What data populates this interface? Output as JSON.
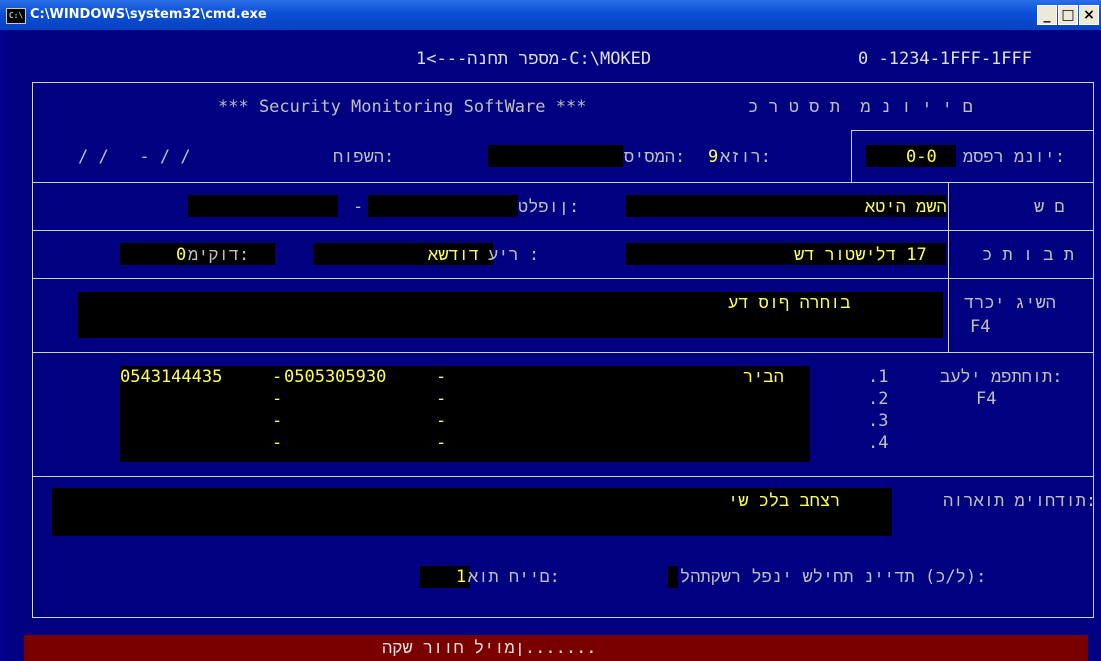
{
  "window": {
    "title": "C:\\WINDOWS\\system32\\cmd.exe",
    "icon": "console-icon",
    "buttons": {
      "minimize": "_",
      "maximize": "□",
      "close": "×"
    }
  },
  "header": {
    "path_line": "1<---הנחת רפסמ-C:\\MOKED",
    "code": "0 -1234-1FFF-1FFF"
  },
  "form": {
    "app_name": "*** Security Monitoring SoftWare ***",
    "title_right": "כ ר ט ס ת  מ נ ו י י ם",
    "vacation_label": "חופשה:",
    "vacation_value": "/ /   - / /",
    "password_label": "סיסמה:",
    "area_label": "אזור:",
    "area_value": "9",
    "subscriber_label": "מספר מנוי:",
    "subscriber_value": "0-0",
    "name_label": "ש ם",
    "name_value": "אטיה משה",
    "phone_label": "טלפון:",
    "phone_sep": "-",
    "address_label": "כ ת ו ב ת",
    "address_value": "שד רוטשילד 17",
    "city_label": "עיר :",
    "city_value": "אשדוד",
    "zip_label": "מיקוד:",
    "zip_value": "0",
    "access_label": "דרכי גישה",
    "access_key": "F4",
    "access_value": "עד סוף הרחוב",
    "keyholders_label": "בעלי מפתחות:",
    "keyholders_key": "F4",
    "keyholders": [
      {
        "num": ".1",
        "name": "ריבה",
        "phone1": "0543144435",
        "sep1": "-",
        "phone2": "0505305930",
        "sep2": "-"
      },
      {
        "num": ".2",
        "name": "",
        "phone1": "",
        "sep1": "-",
        "phone2": "",
        "sep2": "-"
      },
      {
        "num": ".3",
        "name": "",
        "phone1": "",
        "sep1": "-",
        "phone2": "",
        "sep2": "-"
      },
      {
        "num": ".4",
        "name": "",
        "phone1": "",
        "sep1": "-",
        "phone2": "",
        "sep2": "-"
      }
    ],
    "special_label": "הוראות מיוחדות:",
    "special_value": "יש כלב בחצר",
    "call_before_label": "להתקשר לפני שליחת ניידת (כ/ל):",
    "alive_label": "אות חיים:",
    "alive_value": "1"
  },
  "footer": {
    "prompt": "הקש רווח ליומן......."
  },
  "colors": {
    "console_bg": "#000080",
    "field_bg": "#000000",
    "value_text": "#ffff55",
    "label_text": "#c0c0c0",
    "footer_bg": "#7a0000"
  }
}
